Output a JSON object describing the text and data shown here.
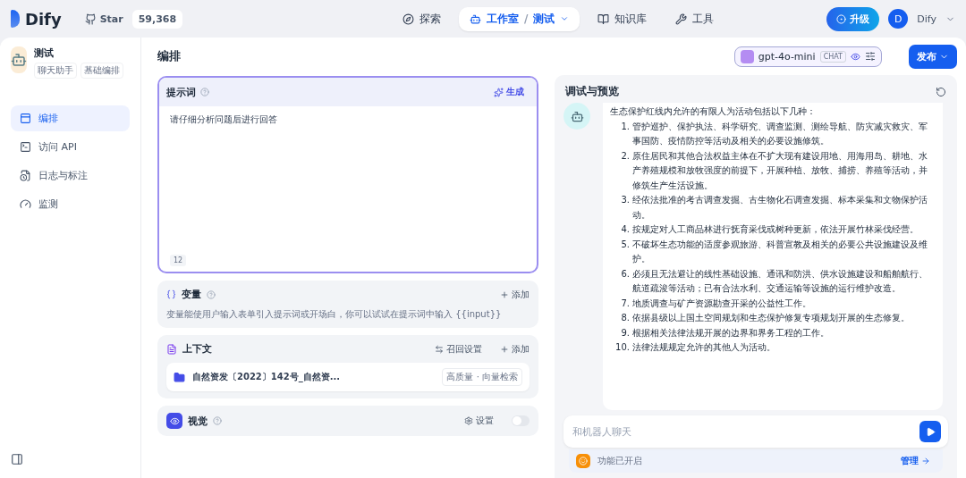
{
  "brand": {
    "name": "Dify",
    "star_label": "Star",
    "star_count": "59,368"
  },
  "nav": [
    {
      "label": "探索",
      "selected": false
    },
    {
      "label": "工作室",
      "separator": "/",
      "sub": "测试",
      "selected": true
    },
    {
      "label": "知识库",
      "selected": false
    },
    {
      "label": "工具",
      "selected": false
    }
  ],
  "upgrade": "升级",
  "user": {
    "initial": "D",
    "name": "Dify"
  },
  "app": {
    "name": "测试",
    "tags": [
      "聊天助手",
      "基础编排"
    ]
  },
  "sidebar": {
    "items": [
      {
        "label": "编排",
        "selected": true
      },
      {
        "label": "访问 API",
        "selected": false
      },
      {
        "label": "日志与标注",
        "selected": false
      },
      {
        "label": "监测",
        "selected": false
      }
    ]
  },
  "page_title": "编排",
  "model": {
    "name": "gpt-4o-mini",
    "badge": "CHAT"
  },
  "publish": "发布",
  "prompt": {
    "title": "提示词",
    "generate": "生成",
    "text": "请仔细分析问题后进行回答",
    "count": "12"
  },
  "variables": {
    "title": "变量",
    "add": "添加",
    "hint": "变量能使用户输入表单引入提示词或开场白，你可以试试在提示词中输入 {{input}}"
  },
  "context": {
    "title": "上下文",
    "retrieval": "召回设置",
    "add": "添加",
    "items": [
      {
        "name": "自然资发〔2022〕142号_自然资...",
        "tag": "高质量 · 向量检索"
      }
    ]
  },
  "vision": {
    "title": "视觉",
    "settings": "设置",
    "on": false
  },
  "preview": {
    "title": "调试与预览",
    "intro": "生态保护红线内允许的有限人为活动包括以下几种：",
    "list": [
      {
        "num": "1.",
        "text": "管护巡护、保护执法、科学研究、调查监测、测绘导航、防灾减灾救灾、军事国防、疫情防控等活动及相关的必要设施修筑。"
      },
      {
        "num": "2.",
        "text": "原住居民和其他合法权益主体在不扩大现有建设用地、用海用岛、耕地、水产养殖规模和放牧强度的前提下，开展种植、放牧、捕捞、养殖等活动，并修筑生产生活设施。"
      },
      {
        "num": "3.",
        "text": "经依法批准的考古调查发掘、古生物化石调查发掘、标本采集和文物保护活动。"
      },
      {
        "num": "4.",
        "text": "按规定对人工商品林进行抚育采伐或树种更新，依法开展竹林采伐经营。"
      },
      {
        "num": "5.",
        "text": "不破坏生态功能的适度参观旅游、科普宣教及相关的必要公共设施建设及维护。"
      },
      {
        "num": "6.",
        "text": "必须且无法避让的线性基础设施、通讯和防洪、供水设施建设和船舶航行、航道疏浚等活动；已有合法水利、交通运输等设施的运行维护改造。"
      },
      {
        "num": "7.",
        "text": "地质调查与矿产资源勘查开采的公益性工作。"
      },
      {
        "num": "8.",
        "text": "依据县级以上国土空间规划和生态保护修复专项规划开展的生态修复。"
      },
      {
        "num": "9.",
        "text": "根据相关法律法规开展的边界和界务工程的工作。"
      },
      {
        "num": "10.",
        "text": "法律法规规定允许的其他人为活动。"
      }
    ],
    "input_placeholder": "和机器人聊天",
    "features": "功能已开启",
    "manage": "管理"
  }
}
